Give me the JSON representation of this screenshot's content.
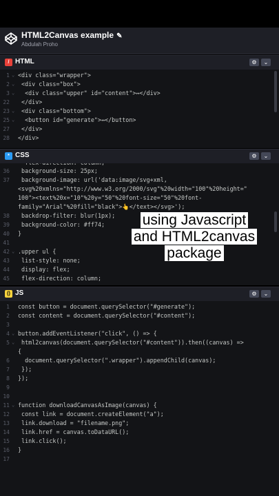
{
  "header": {
    "title": "HTML2Canvas example",
    "author": "Abdulah Proho"
  },
  "panes": {
    "html": {
      "label": "HTML"
    },
    "css": {
      "label": "CSS"
    },
    "js": {
      "label": "JS"
    }
  },
  "html_code": [
    {
      "ln": "1",
      "fold": "⌄",
      "text": "<div class=\"wrapper\">"
    },
    {
      "ln": "2",
      "fold": "⌄",
      "text": " <div class=\"box\">"
    },
    {
      "ln": "3",
      "fold": "⌄",
      "text": "  <div class=\"upper\" id=\"content\">↔</div>"
    },
    {
      "ln": "22",
      "fold": "",
      "text": " </div>"
    },
    {
      "ln": "23",
      "fold": "⌄",
      "text": " <div class=\"bottom\">"
    },
    {
      "ln": "25",
      "fold": "⌄",
      "text": "  <button id=\"generate\">↔</button>"
    },
    {
      "ln": "27",
      "fold": "",
      "text": " </div>"
    },
    {
      "ln": "28",
      "fold": "",
      "text": "</div>"
    }
  ],
  "css_code": [
    {
      "ln": "36",
      "fold": "",
      "text": " background-size: 25px;"
    },
    {
      "ln": "37",
      "fold": "",
      "text": " background-image: url('data:image/svg+xml,"
    },
    {
      "ln": "",
      "fold": "",
      "text": "<svg%20xmlns=\"http://www.w3.org/2000/svg\"%20width=\"100\"%20height=\""
    },
    {
      "ln": "",
      "fold": "",
      "text": "100\"><text%20x=\"10\"%20y=\"50\"%20font-size=\"50\"%20font-"
    },
    {
      "ln": "",
      "fold": "",
      "text": "family=\"Arial\"%20fill=\"black\">👆</text></svg>');"
    },
    {
      "ln": "38",
      "fold": "",
      "text": " backdrop-filter: blur(1px);"
    },
    {
      "ln": "39",
      "fold": "",
      "text": " background-color: #ff74;"
    },
    {
      "ln": "40",
      "fold": "",
      "text": "}"
    },
    {
      "ln": "41",
      "fold": "",
      "text": ""
    },
    {
      "ln": "42",
      "fold": "⌄",
      "text": ".upper ul {"
    },
    {
      "ln": "43",
      "fold": "",
      "text": " list-style: none;"
    },
    {
      "ln": "44",
      "fold": "",
      "text": " display: flex;"
    },
    {
      "ln": "45",
      "fold": "",
      "text": " flex-direction: column;"
    }
  ],
  "js_code": [
    {
      "ln": "1",
      "fold": "",
      "text": "const button = document.querySelector(\"#generate\");"
    },
    {
      "ln": "2",
      "fold": "",
      "text": "const content = document.querySelector(\"#content\");"
    },
    {
      "ln": "3",
      "fold": "",
      "text": ""
    },
    {
      "ln": "4",
      "fold": "⌄",
      "text": "button.addEventListener(\"click\", () => {"
    },
    {
      "ln": "5",
      "fold": "⌄",
      "text": " html2canvas(document.querySelector(\"#content\")).then((canvas) =>"
    },
    {
      "ln": "",
      "fold": "",
      "text": "{"
    },
    {
      "ln": "6",
      "fold": "",
      "text": "  document.querySelector(\".wrapper\").appendChild(canvas);"
    },
    {
      "ln": "7",
      "fold": "",
      "text": " });"
    },
    {
      "ln": "8",
      "fold": "",
      "text": "});"
    },
    {
      "ln": "9",
      "fold": "",
      "text": ""
    },
    {
      "ln": "10",
      "fold": "",
      "text": ""
    },
    {
      "ln": "11",
      "fold": "⌄",
      "text": "function downloadCanvasAsImage(canvas) {"
    },
    {
      "ln": "12",
      "fold": "",
      "text": " const link = document.createElement(\"a\");"
    },
    {
      "ln": "13",
      "fold": "",
      "text": " link.download = \"filename.png\";"
    },
    {
      "ln": "14",
      "fold": "",
      "text": " link.href = canvas.toDataURL();"
    },
    {
      "ln": "15",
      "fold": "",
      "text": " link.click();"
    },
    {
      "ln": "16",
      "fold": "",
      "text": "}"
    },
    {
      "ln": "17",
      "fold": "",
      "text": ""
    }
  ],
  "css_partial_top": "  flex-direction: column;",
  "overlay": {
    "line1": "using Javascript",
    "line2": "and HTML2canvas",
    "line3": "package"
  },
  "colors": {
    "html_badge": "#e8413a",
    "css_badge": "#2b9bf4",
    "js_badge": "#f7d23d"
  }
}
